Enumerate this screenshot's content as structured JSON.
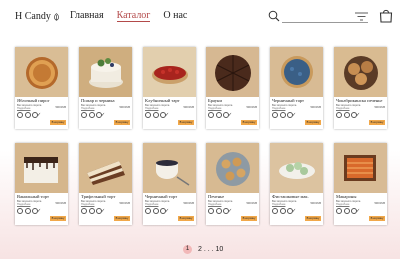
{
  "header": {
    "logo_text": "H Candy",
    "nav": [
      {
        "label": "Главная",
        "active": false
      },
      {
        "label": "Каталог",
        "active": true
      },
      {
        "label": "О нас",
        "active": false
      }
    ],
    "icons": [
      "search-icon",
      "filter-icon",
      "bag-icon"
    ]
  },
  "products": [
    {
      "name": "Яблочный пирог",
      "weight": "Вес вкусного пирога",
      "more": "Подробнее",
      "price": "500 RUB",
      "cart": "В корзину"
    },
    {
      "name": "Пожар и черника",
      "weight": "Вес вкусного пирога",
      "more": "Подробнее",
      "price": "500 RUB",
      "cart": "В корзину"
    },
    {
      "name": "Клубничный тарт",
      "weight": "Вес вкусного пирога",
      "more": "Подробнее",
      "price": "500 RUB",
      "cart": "В корзину"
    },
    {
      "name": "Брауни",
      "weight": "Вес вкусного пирога",
      "more": "Подробнее",
      "price": "500 RUB",
      "cart": "В корзину"
    },
    {
      "name": "Черничный тарт",
      "weight": "Вес вкусного пирога",
      "more": "Подробнее",
      "price": "500 RUB",
      "cart": "В корзину"
    },
    {
      "name": "Чокабрикинска печенье",
      "weight": "Вес вкусного пирога",
      "more": "Подробнее",
      "price": "500 RUB",
      "cart": "В корзину"
    },
    {
      "name": "Ванильный торт",
      "weight": "Вес вкусного пирога",
      "more": "Подробнее",
      "price": "500 RUB",
      "cart": "В корзину"
    },
    {
      "name": "Трифельный торт",
      "weight": "Вес вкусного пирога",
      "more": "Подробнее",
      "price": "500 RUB",
      "cart": "В корзину"
    },
    {
      "name": "Черничный торт",
      "weight": "Вес вкусного пирога",
      "more": "Подробнее",
      "price": "500 RUB",
      "cart": "В корзину"
    },
    {
      "name": "Печенье",
      "weight": "Вес вкусного пирога",
      "more": "Подробнее",
      "price": "500 RUB",
      "cart": "В корзину"
    },
    {
      "name": "Фисташковые мак.",
      "weight": "Вес вкусного пирога",
      "more": "Подробнее",
      "price": "500 RUB",
      "cart": "В корзину"
    },
    {
      "name": "Макароны",
      "weight": "Вес вкусного пирога",
      "more": "Подробнее",
      "price": "500 RUB",
      "cart": "В корзину"
    }
  ],
  "pagination": {
    "current": "1",
    "rest": "2 . . . 10"
  },
  "colors": {
    "accent": "#b34a4a",
    "cart_button": "#f1a84a",
    "photo_bg": "#d8bd97",
    "footer_tint": "#f7e3e3"
  }
}
